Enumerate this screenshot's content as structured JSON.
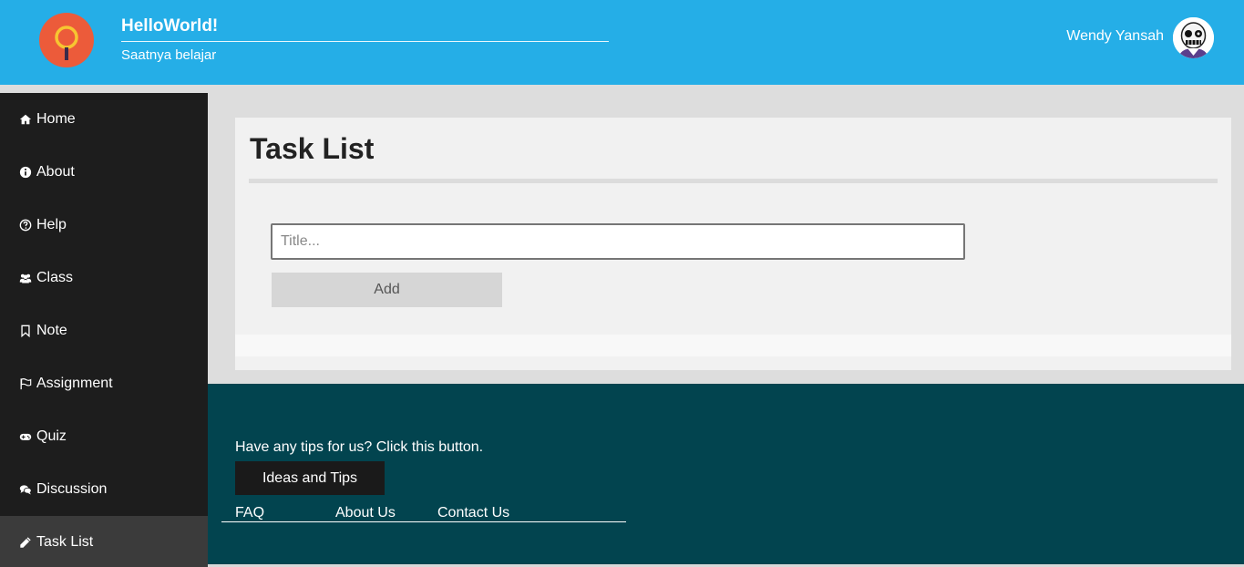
{
  "header": {
    "title": "HelloWorld!",
    "subtitle": "Saatnya belajar",
    "user_name": "Wendy Yansah",
    "logo_icon": "magnifier-logo-icon",
    "brand_color": "#25aee7",
    "logo_color": "#ec5b3a"
  },
  "sidebar": {
    "items": [
      {
        "label": "Home",
        "icon": "home-icon"
      },
      {
        "label": "About",
        "icon": "info-icon"
      },
      {
        "label": "Help",
        "icon": "question-icon"
      },
      {
        "label": "Class",
        "icon": "users-icon"
      },
      {
        "label": "Note",
        "icon": "bookmark-icon"
      },
      {
        "label": "Assignment",
        "icon": "flag-icon"
      },
      {
        "label": "Quiz",
        "icon": "gamepad-icon"
      },
      {
        "label": "Discussion",
        "icon": "comments-icon"
      },
      {
        "label": "Task List",
        "icon": "pencil-icon",
        "active": true
      }
    ]
  },
  "main": {
    "title": "Task List",
    "input": {
      "value": "",
      "placeholder": "Title..."
    },
    "add_label": "Add"
  },
  "footer": {
    "tips_text": "Have any tips for us? Click this button.",
    "ideas_button": "Ideas and Tips",
    "links": [
      "FAQ",
      "About Us",
      "Contact Us"
    ],
    "background": "#02444f"
  }
}
